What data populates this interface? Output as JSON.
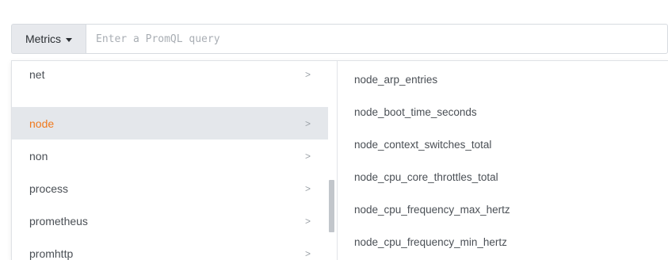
{
  "query_bar": {
    "metrics_button_label": "Metrics",
    "query_placeholder": "Enter a PromQL query"
  },
  "categories": [
    {
      "label": "net",
      "chevron": ">",
      "active": false
    },
    {
      "label": "node",
      "chevron": ">",
      "active": true
    },
    {
      "label": "non",
      "chevron": ">",
      "active": false
    },
    {
      "label": "process",
      "chevron": ">",
      "active": false
    },
    {
      "label": "prometheus",
      "chevron": ">",
      "active": false
    },
    {
      "label": "promhttp",
      "chevron": ">",
      "active": false
    }
  ],
  "metrics": [
    "node_arp_entries",
    "node_boot_time_seconds",
    "node_context_switches_total",
    "node_cpu_core_throttles_total",
    "node_cpu_frequency_max_hertz",
    "node_cpu_frequency_min_hertz"
  ],
  "colors": {
    "active_text": "#f0791c",
    "active_background": "#e4e7eb",
    "button_background": "#e7e9ed"
  },
  "icons": {
    "dropdown_caret": "caret-down-icon",
    "category_chevron": "chevron-right-icon"
  }
}
